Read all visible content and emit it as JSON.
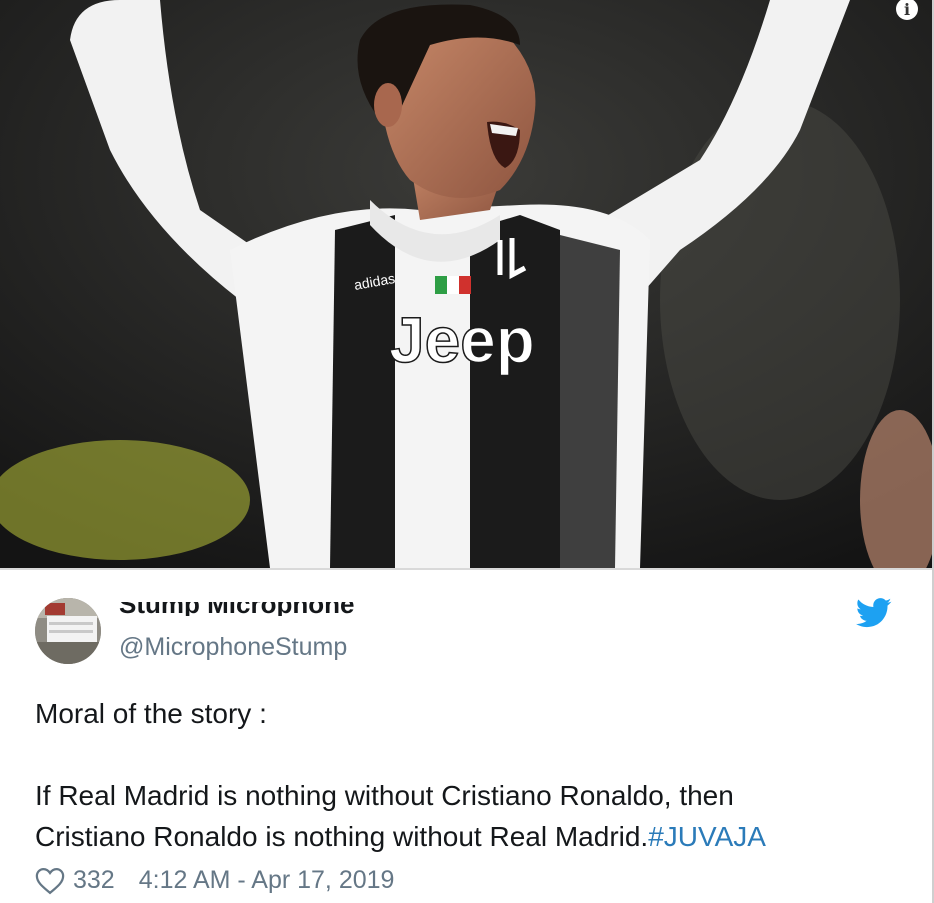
{
  "media": {
    "jersey_sponsor": "Jeep",
    "jersey_brand": "adidas"
  },
  "tweet": {
    "display_name": "Stump Microphone",
    "handle": "@MicrophoneStump",
    "text_line1": "Moral of the story :",
    "text_line2a": "If Real Madrid is nothing without Cristiano Ronaldo, then",
    "text_line2b": "Cristiano Ronaldo is nothing without Real Madrid.",
    "hashtag": "#JUVAJA",
    "likes": "332",
    "timestamp": "4:12 AM - Apr 17, 2019"
  },
  "icons": [
    "info-icon",
    "twitter-bird-icon",
    "heart-icon"
  ],
  "colors": {
    "handle": "#657786",
    "hashtag": "#2b7bb9",
    "twitter_blue": "#1da1f2"
  }
}
